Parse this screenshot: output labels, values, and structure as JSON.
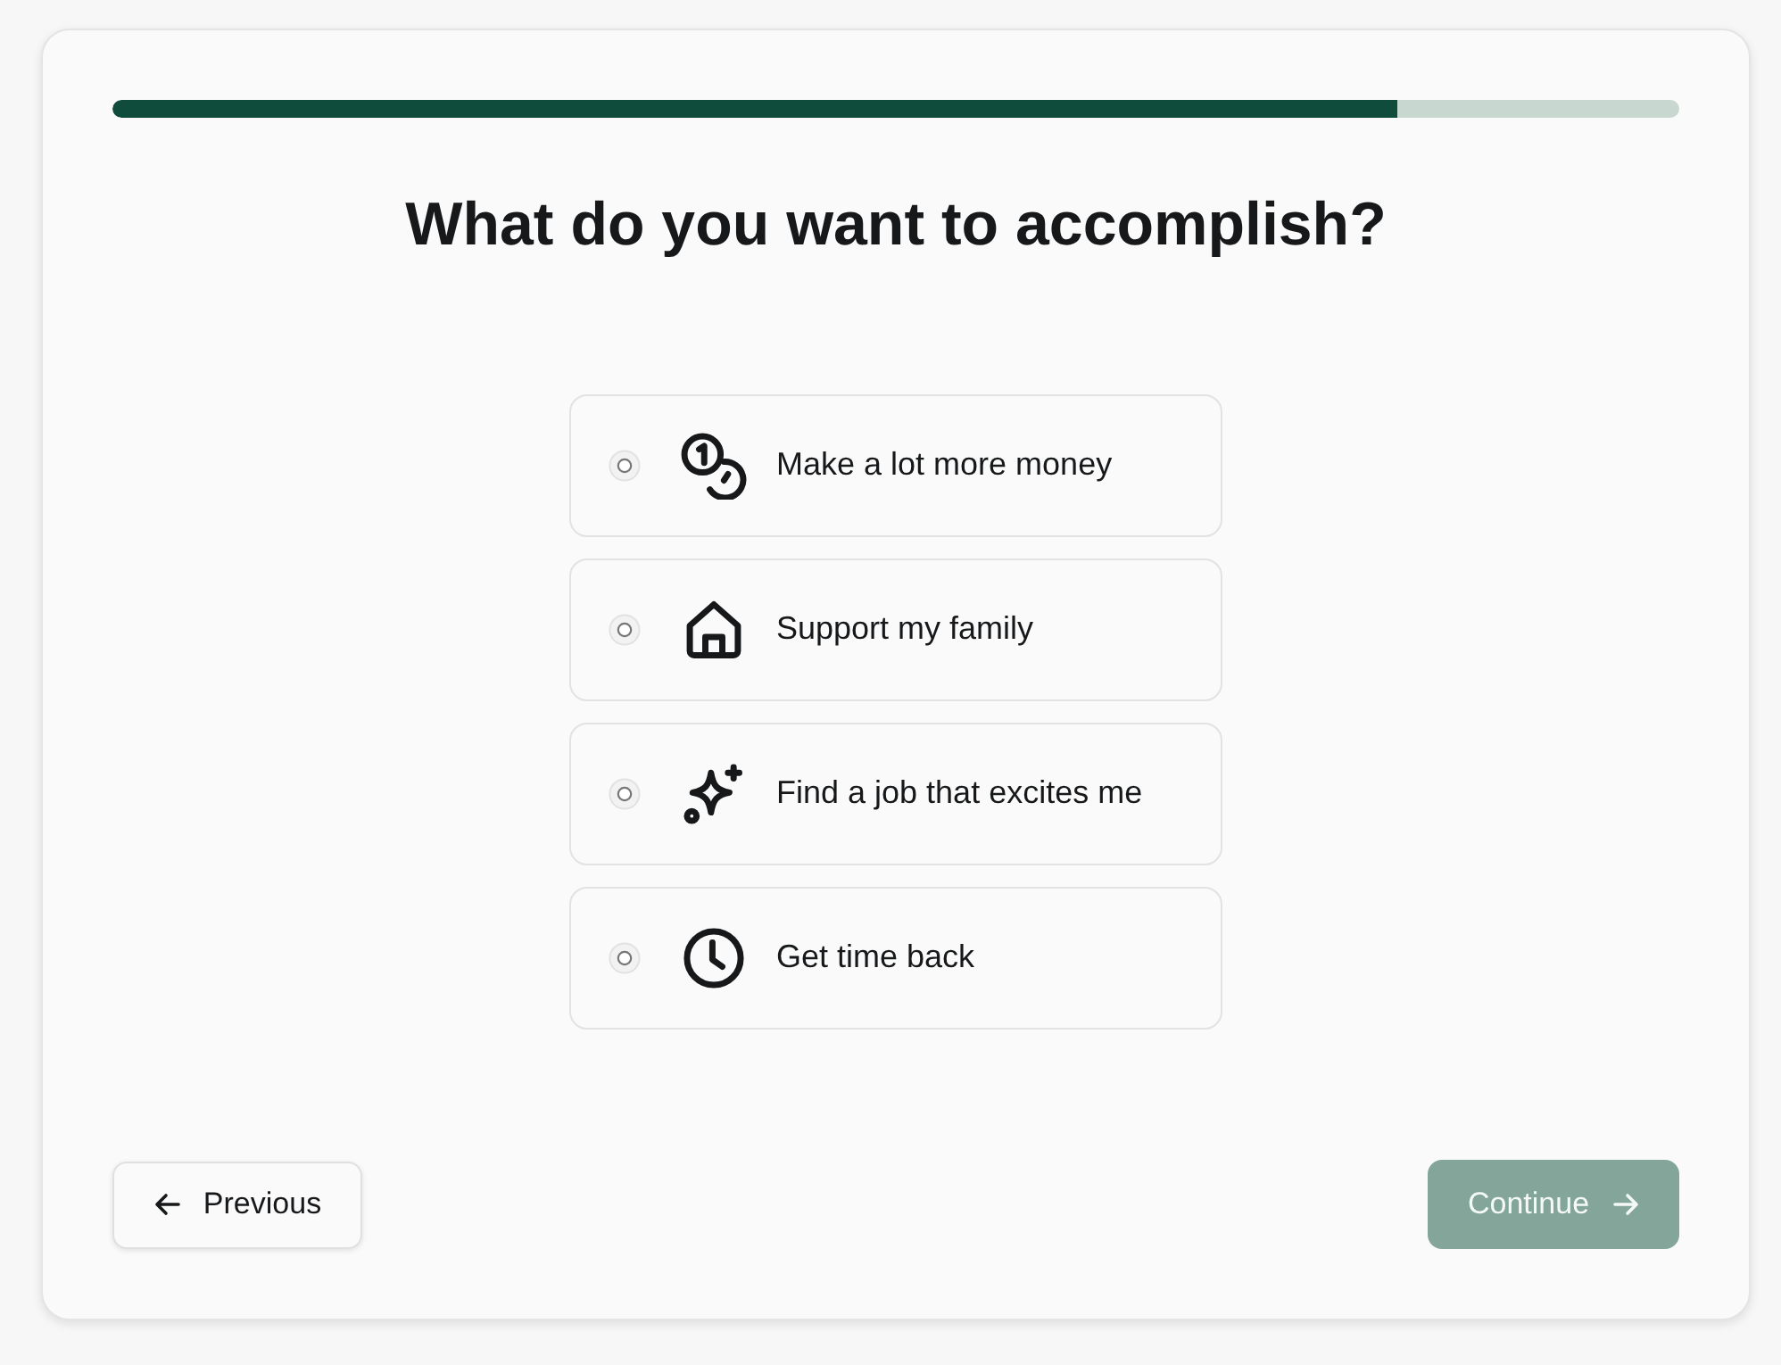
{
  "progress": {
    "level": 0.82
  },
  "title": "What do you want to accomplish?",
  "options": [
    {
      "label": "Make a lot more money",
      "selected": false
    },
    {
      "label": "Support my family",
      "selected": false
    },
    {
      "label": "Find a job that excites me",
      "selected": false
    },
    {
      "label": "Get time back",
      "selected": false
    }
  ],
  "buttons": {
    "previous": {
      "label": "Previous"
    },
    "continue": {
      "label": "Continue",
      "disabled": true
    }
  }
}
